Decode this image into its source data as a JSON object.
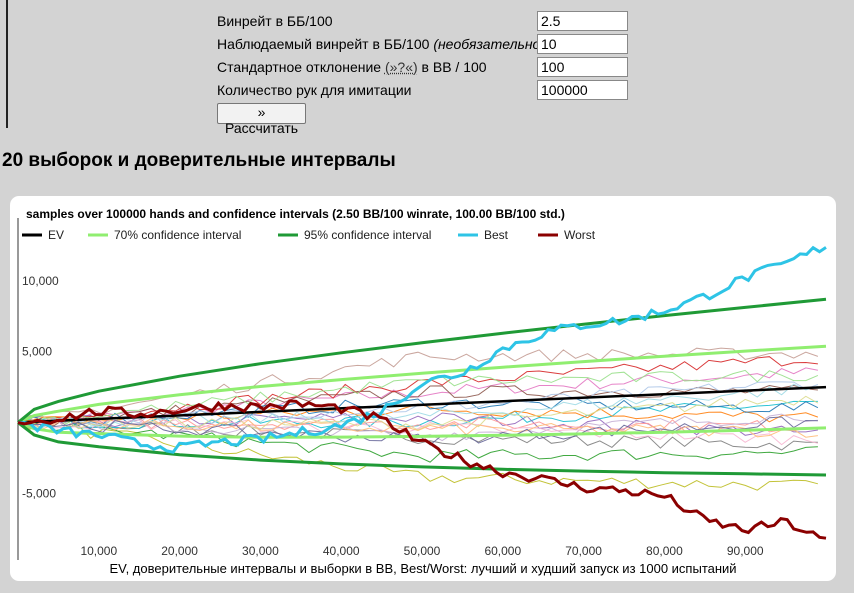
{
  "form": {
    "winrate_label": "Винрейт в ББ/100",
    "winrate_value": "2.5",
    "observed_label": "Наблюдаемый винрейт в ББ/100 ",
    "observed_hint": "(необязательно)",
    "observed_value": "10",
    "std_label_pre": "Стандартное отклонение ",
    "std_link": "(»?«)",
    "std_label_post": " в BB / 100",
    "std_value": "100",
    "hands_label": "Количество рук для имитации",
    "hands_value": "100000",
    "calc_button": "» Рассчитать"
  },
  "section_title": "20 выборок и доверительные интервалы",
  "chart_data": {
    "type": "line",
    "title": "samples over 100000 hands and confidence intervals (2.50 BB/100 winrate, 100.00 BB/100 std.)",
    "caption": "EV, доверительные интервалы и выборки в BB, Best/Worst: лучший и худший запуск из 1000 испытаний",
    "xlabel": "",
    "ylabel": "",
    "xlim": [
      0,
      100000
    ],
    "ylim": [
      -9700,
      13300
    ],
    "x_ticks": [
      10000,
      20000,
      30000,
      40000,
      50000,
      60000,
      70000,
      80000,
      90000
    ],
    "x_tick_labels": [
      "10,000",
      "20,000",
      "30,000",
      "40,000",
      "50,000",
      "60,000",
      "70,000",
      "80,000",
      "90,000"
    ],
    "y_ticks": [
      10000,
      5000,
      -5000
    ],
    "y_tick_labels": [
      "10,000",
      "5,000",
      "-5,000"
    ],
    "grid": false,
    "legend_position": "top",
    "legend": [
      {
        "name": "EV",
        "color": "#000000"
      },
      {
        "name": "70% confidence interval",
        "color": "#90ee70"
      },
      {
        "name": "95% confidence interval",
        "color": "#1f9a36"
      },
      {
        "name": "Best",
        "color": "#2ec4e6"
      },
      {
        "name": "Worst",
        "color": "#8b0000"
      }
    ],
    "winrate_bb100": 2.5,
    "std_bb100": 100,
    "hands": 100000,
    "ev": {
      "x": [
        0,
        100000
      ],
      "y": [
        0,
        2500
      ]
    },
    "ci70": {
      "x": [
        0,
        2000,
        5000,
        10000,
        20000,
        30000,
        40000,
        50000,
        60000,
        70000,
        80000,
        90000,
        100000
      ],
      "upper": [
        0,
        490,
        800,
        1280,
        1960,
        2540,
        3030,
        3480,
        3900,
        4300,
        4680,
        5040,
        5380
      ],
      "lower": [
        0,
        -440,
        -690,
        -780,
        -960,
        -1040,
        -1030,
        -980,
        -900,
        -800,
        -680,
        -540,
        -380
      ]
    },
    "ci95": {
      "x": [
        0,
        2000,
        5000,
        10000,
        20000,
        30000,
        40000,
        50000,
        60000,
        70000,
        80000,
        90000,
        100000
      ],
      "upper": [
        0,
        930,
        1490,
        2210,
        3270,
        4150,
        4920,
        5630,
        6300,
        6930,
        7540,
        8120,
        8700
      ],
      "lower": [
        0,
        -880,
        -1370,
        -1710,
        -2270,
        -2650,
        -2920,
        -3130,
        -3300,
        -3430,
        -3540,
        -3620,
        -3700
      ]
    },
    "best": {
      "x": [
        0,
        5000,
        10000,
        15000,
        20000,
        25000,
        30000,
        35000,
        40000,
        45000,
        50000,
        55000,
        60000,
        65000,
        70000,
        75000,
        80000,
        85000,
        90000,
        95000,
        100000
      ],
      "y": [
        0,
        -600,
        -900,
        -1500,
        -1800,
        -1400,
        -1200,
        -700,
        -200,
        800,
        2800,
        3500,
        5200,
        6300,
        6900,
        7200,
        7900,
        8900,
        10200,
        11200,
        12500
      ]
    },
    "worst": {
      "x": [
        0,
        5000,
        10000,
        15000,
        20000,
        25000,
        30000,
        35000,
        40000,
        45000,
        50000,
        55000,
        60000,
        65000,
        70000,
        75000,
        80000,
        85000,
        90000,
        95000,
        100000
      ],
      "y": [
        0,
        300,
        800,
        600,
        900,
        1200,
        1100,
        1300,
        1000,
        200,
        -1500,
        -2600,
        -3500,
        -4000,
        -4600,
        -4800,
        -5200,
        -6900,
        -7600,
        -7000,
        -8400
      ]
    }
  }
}
